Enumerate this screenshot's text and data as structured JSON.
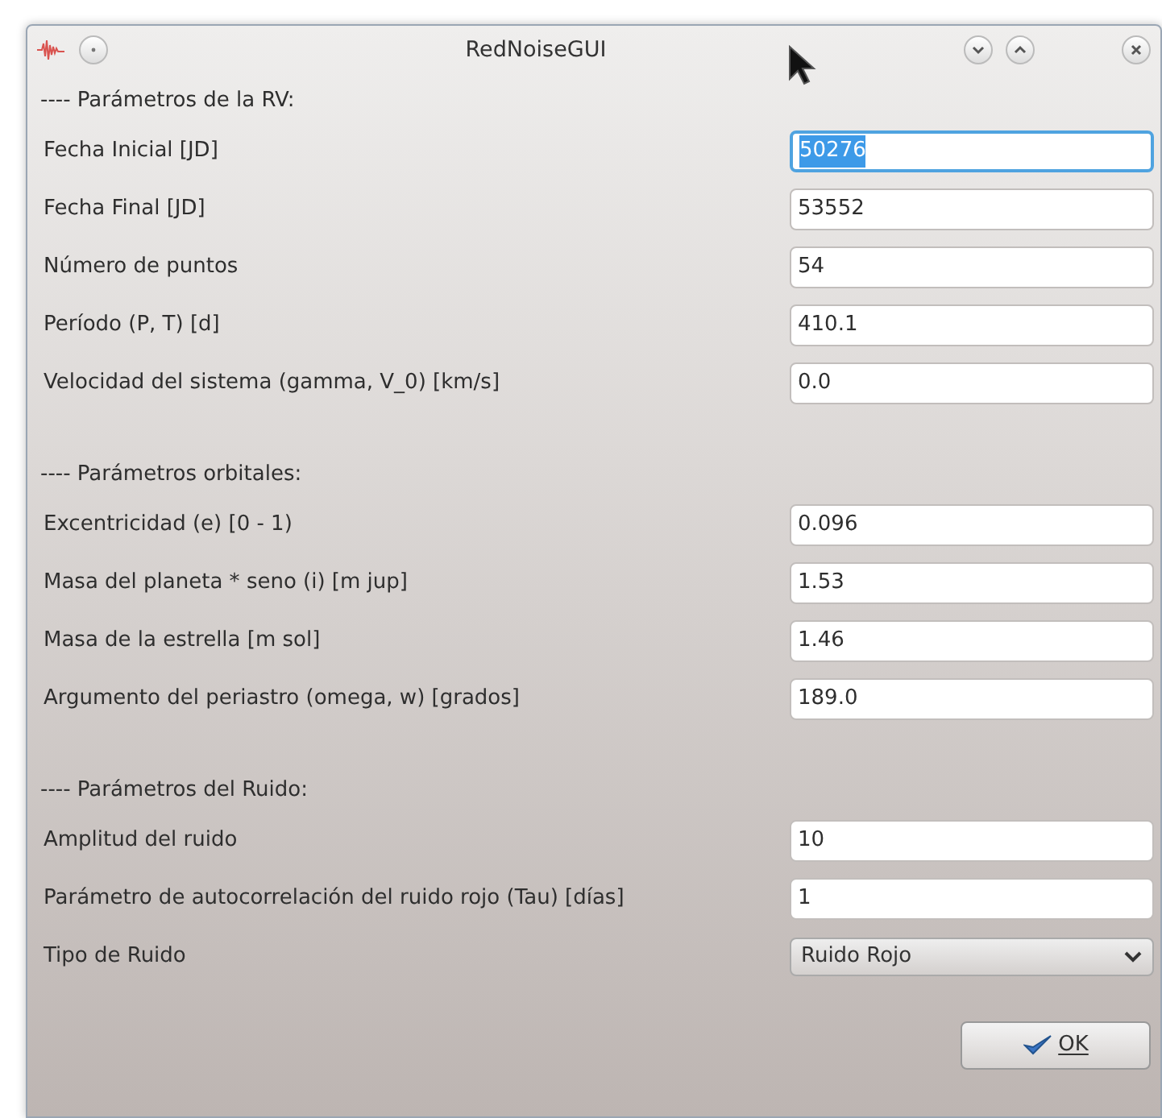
{
  "window": {
    "title": "RedNoiseGUI"
  },
  "sections": [
    {
      "header": "---- Parámetros de la RV:",
      "fields": [
        {
          "kind": "text",
          "label": "Fecha Inicial [JD]",
          "value": "50276",
          "focused": true
        },
        {
          "kind": "text",
          "label": "Fecha Final [JD]",
          "value": "53552",
          "focused": false
        },
        {
          "kind": "text",
          "label": "Número de puntos",
          "value": "54",
          "focused": false
        },
        {
          "kind": "text",
          "label": "Período (P, T) [d]",
          "value": "410.1",
          "focused": false
        },
        {
          "kind": "text",
          "label": "Velocidad del sistema (gamma, V_0) [km/s]",
          "value": "0.0",
          "focused": false
        }
      ]
    },
    {
      "header": "---- Parámetros orbitales:",
      "fields": [
        {
          "kind": "text",
          "label": "Excentricidad (e) [0 - 1)",
          "value": "0.096",
          "focused": false
        },
        {
          "kind": "text",
          "label": "Masa del planeta * seno (i) [m jup]",
          "value": "1.53",
          "focused": false
        },
        {
          "kind": "text",
          "label": "Masa de la estrella [m sol]",
          "value": "1.46",
          "focused": false
        },
        {
          "kind": "text",
          "label": "Argumento del periastro (omega, w) [grados]",
          "value": "189.0",
          "focused": false
        }
      ]
    },
    {
      "header": "---- Parámetros del Ruido:",
      "fields": [
        {
          "kind": "text",
          "label": "Amplitud del ruido",
          "value": "10",
          "focused": false
        },
        {
          "kind": "text",
          "label": "Parámetro de autocorrelación del ruido rojo (Tau) [días]",
          "value": "1",
          "focused": false
        },
        {
          "kind": "select",
          "label": "Tipo de Ruido",
          "value": "Ruido Rojo",
          "focused": false
        }
      ]
    }
  ],
  "ok_button": {
    "label": "OK"
  }
}
